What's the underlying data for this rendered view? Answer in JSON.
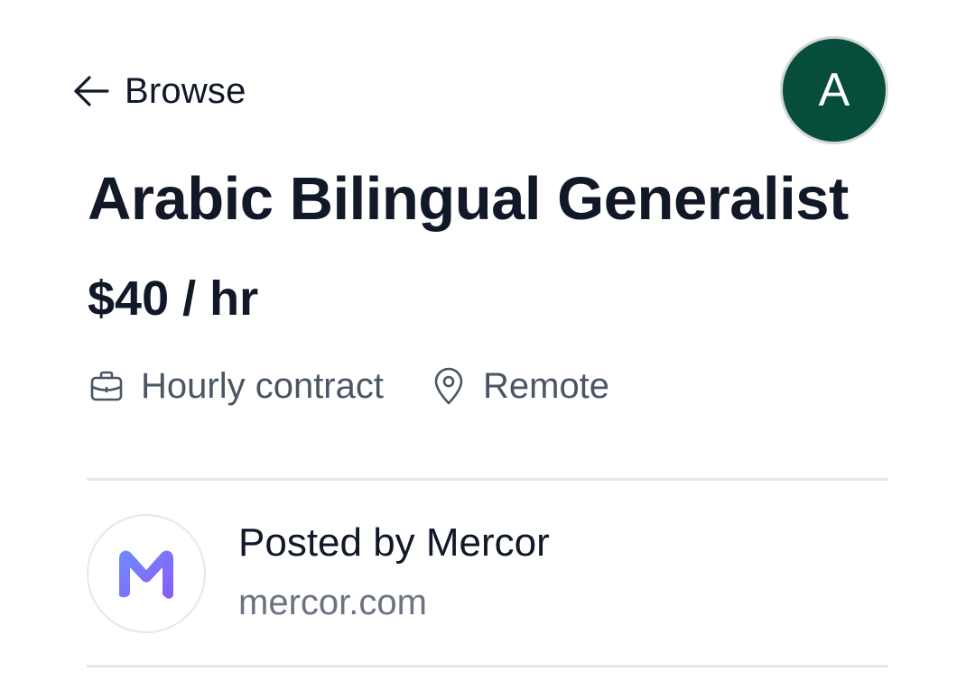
{
  "header": {
    "back_label": "Browse",
    "back_icon": "arrow-left-icon",
    "avatar_initial": "A",
    "avatar_color": "#064d3b"
  },
  "job": {
    "title": "Arabic Bilingual Generalist",
    "rate": "$40 / hr",
    "meta": [
      {
        "icon": "briefcase-icon",
        "label": "Hourly contract"
      },
      {
        "icon": "map-pin-icon",
        "label": "Remote"
      }
    ]
  },
  "company": {
    "posted_by": "Posted by Mercor",
    "url": "mercor.com",
    "logo_icon": "mercor-logo-icon",
    "brand_color": "#7c6cf5"
  }
}
